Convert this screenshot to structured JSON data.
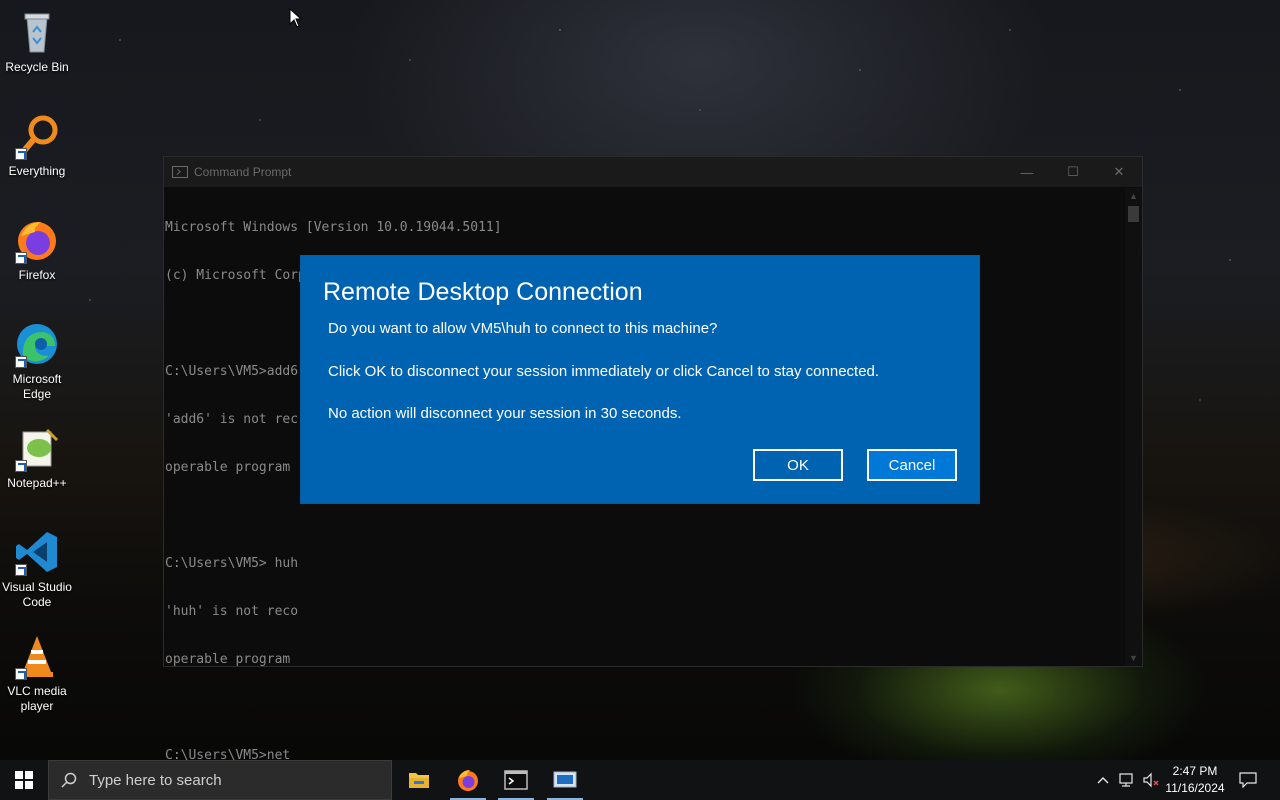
{
  "desktop": {
    "icons": [
      {
        "label": "Recycle Bin",
        "icon": "recycle-bin-icon"
      },
      {
        "label": "Everything",
        "icon": "everything-search-icon"
      },
      {
        "label": "Firefox",
        "icon": "firefox-icon"
      },
      {
        "label": "Microsoft Edge",
        "icon": "edge-icon"
      },
      {
        "label": "Notepad++",
        "icon": "notepadpp-icon"
      },
      {
        "label": "Visual Studio Code",
        "icon": "vscode-icon"
      },
      {
        "label": "VLC media player",
        "icon": "vlc-icon"
      }
    ]
  },
  "cmd": {
    "title": "Command Prompt",
    "lines": [
      "Microsoft Windows [Version 10.0.19044.5011]",
      "(c) Microsoft Corporation. All rights reserved.",
      "",
      "C:\\Users\\VM5>add6",
      "'add6' is not rec",
      "operable program",
      "",
      "C:\\Users\\VM5> huh",
      "'huh' is not reco",
      "operable program",
      "",
      "C:\\Users\\VM5>net"
    ]
  },
  "dialog": {
    "title": "Remote Desktop Connection",
    "question": "Do you want to allow VM5\\huh to connect to this machine?",
    "instruction": "Click OK to disconnect your session immediately or click Cancel to stay connected.",
    "timeout_note": "No action will disconnect your session in 30 seconds.",
    "ok_label": "OK",
    "cancel_label": "Cancel"
  },
  "taskbar": {
    "search_placeholder": "Type here to search",
    "apps": [
      "file-explorer-icon",
      "firefox-icon",
      "command-prompt-icon",
      "remote-desktop-icon"
    ],
    "time": "2:47 PM",
    "date": "11/16/2024"
  },
  "colors": {
    "dialog_bg": "#0063b1",
    "cancel_bg": "#0078d7",
    "taskbar_bg": "#101214"
  }
}
